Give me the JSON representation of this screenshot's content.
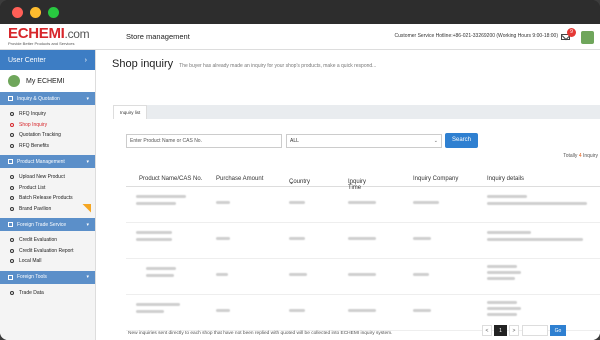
{
  "header": {
    "logo": "ECHEMI",
    "logo_suffix": ".com",
    "logo_tagline": "Provide Better Products and Services",
    "section_title": "Store management",
    "hotline": "Customer Service Hotline:+86-021-33269200 (Working Hours 9:00-18:00)",
    "notification_count": "9"
  },
  "sidebar": {
    "user_center": "User Center",
    "my_echemi": "My ECHEMI",
    "sections": [
      {
        "title": "Inquiry & Quotation",
        "items": [
          "RFQ Inquiry",
          "Shop Inquiry",
          "Quotation Tracking",
          "RFQ Benefits"
        ]
      },
      {
        "title": "Product Management",
        "items": [
          "Upload New Product",
          "Product List",
          "Batch Release Products",
          "Brand Pavilion"
        ]
      },
      {
        "title": "Foreign Trade Service",
        "items": [
          "Credit Evaluation",
          "Credit Evaluation Report",
          "Local Mall"
        ]
      },
      {
        "title": "Foreign Tools",
        "items": [
          "Trade Data"
        ]
      }
    ]
  },
  "main": {
    "title": "Shop inquiry",
    "description": "The buyer has already made an inquiry for your shop's products, make a quick respond...",
    "tab": "Inquiry list",
    "search_placeholder": "Enter Product Name or CAS No.",
    "select_value": "ALL",
    "search_button": "Search",
    "totals_prefix": "Totally",
    "totals_count": "4",
    "totals_suffix": "Inquiry",
    "columns": [
      "Product Name/CAS No.",
      "Purchase Amount",
      "Country",
      "Inquiry Time",
      "Inquiry Company",
      "Inquiry details"
    ],
    "footnote": "New inquiries sent directly to each shop that have not been replied with quoted will be collected into ECHEMI inquiry system.",
    "pager": {
      "prev": "<",
      "current": "1",
      "next": ">",
      "go": "Go"
    }
  }
}
